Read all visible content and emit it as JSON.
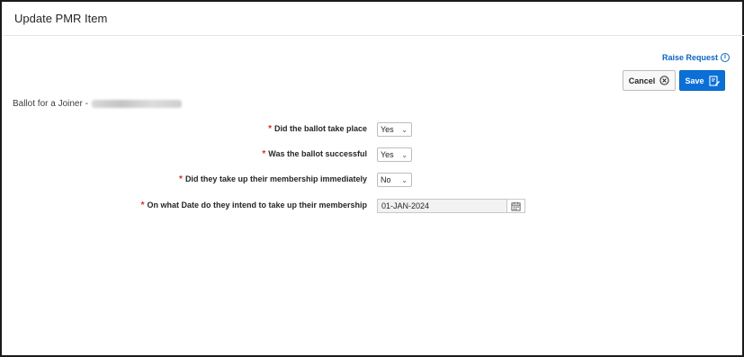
{
  "dialog": {
    "title": "Update PMR Item"
  },
  "header_actions": {
    "raise_request_label": "Raise Request",
    "cancel_label": "Cancel",
    "save_label": "Save"
  },
  "section": {
    "title": "Ballot for a Joiner -"
  },
  "form": {
    "fields": [
      {
        "label": "Did the ballot take place",
        "value": "Yes",
        "type": "select",
        "required": true
      },
      {
        "label": "Was the ballot successful",
        "value": "Yes",
        "type": "select",
        "required": true
      },
      {
        "label": "Did they take up their membership immediately",
        "value": "No",
        "type": "select",
        "required": true
      },
      {
        "label": "On what Date do they intend to take up their membership",
        "value": "01-JAN-2024",
        "type": "date",
        "required": true
      }
    ],
    "required_marker": "*"
  },
  "icons": {
    "info": "info-icon",
    "cancel": "close-circle-icon",
    "save": "save-edit-icon",
    "chevron": "chevron-down-icon",
    "calendar": "calendar-icon"
  },
  "colors": {
    "accent": "#0a70d8",
    "required": "#d32f2f"
  }
}
